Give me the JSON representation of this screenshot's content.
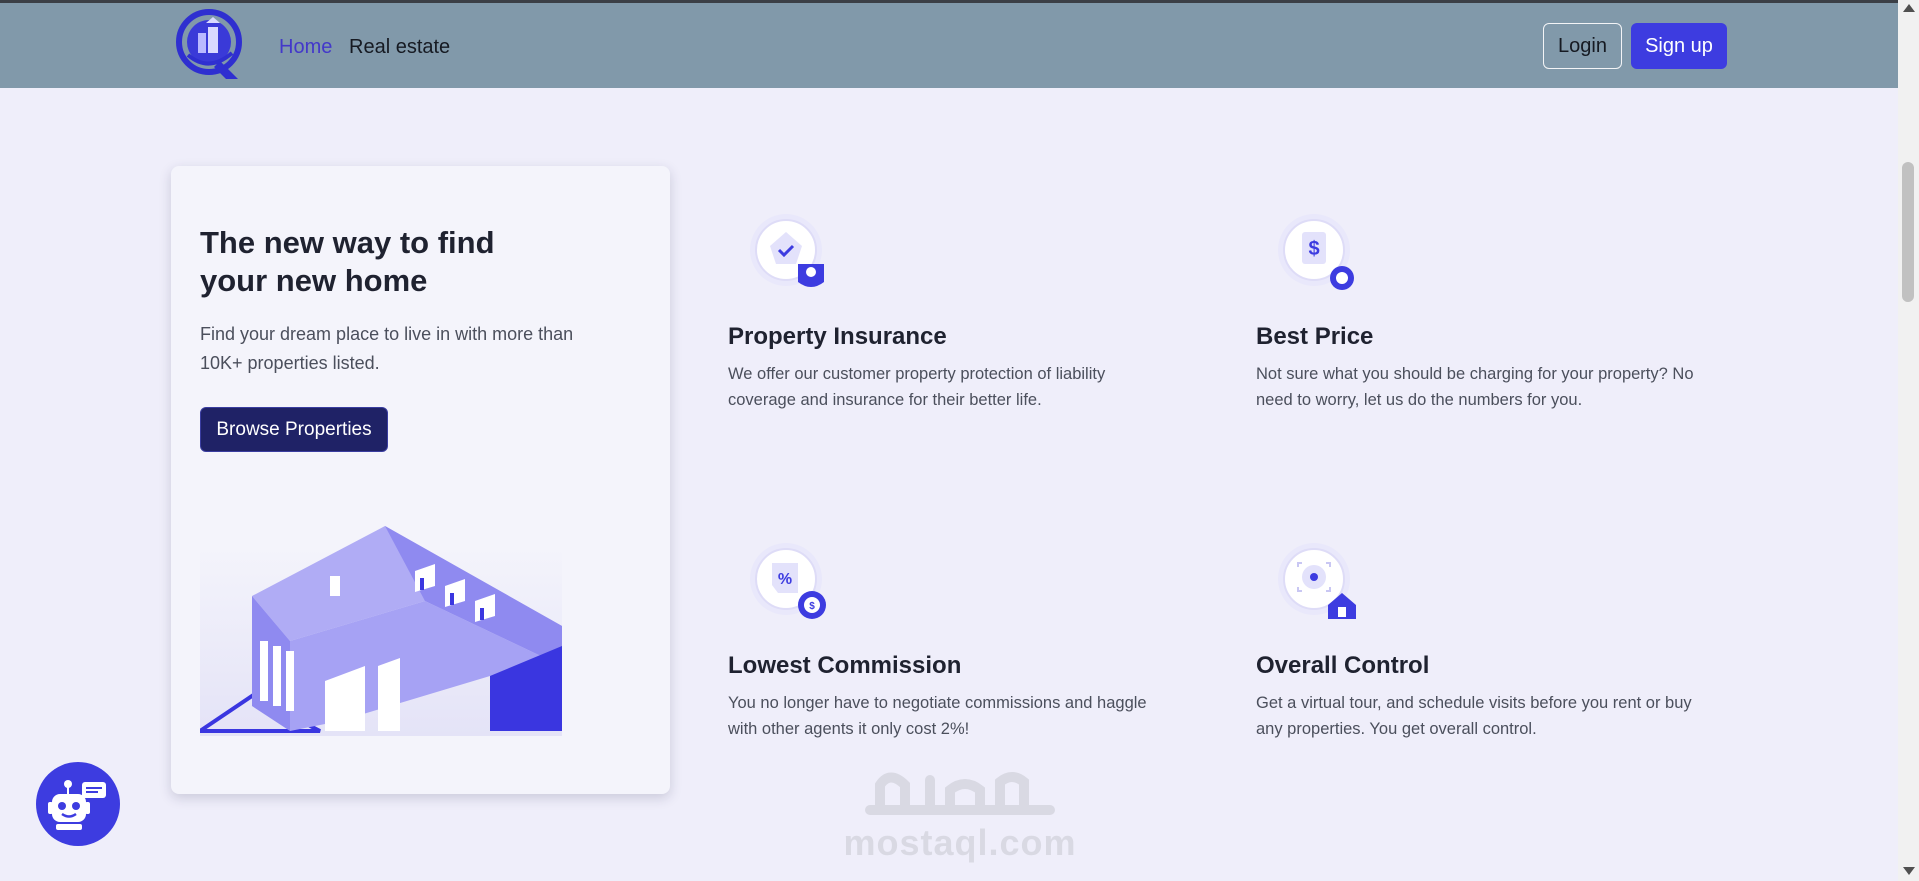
{
  "navbar": {
    "links": [
      {
        "label": "Home"
      },
      {
        "label": "Real estate"
      }
    ],
    "login_label": "Login",
    "signup_label": "Sign up"
  },
  "hero": {
    "title": "The new way to find your new home",
    "subtitle": "Find your dream place to live in with more than 10K+ properties listed.",
    "cta_label": "Browse Properties"
  },
  "features": [
    {
      "title": "Property Insurance",
      "description": "We offer our customer property protection of liability coverage and insurance for their better life.",
      "icon": "shield-house-icon"
    },
    {
      "title": "Best Price",
      "description": "Not sure what you should be charging for your property? No need to worry, let us do the numbers for you.",
      "icon": "price-tag-icon"
    },
    {
      "title": "Lowest Commission",
      "description": "You no longer have to negotiate commissions and haggle with other agents it only cost 2%!",
      "icon": "percent-tag-icon"
    },
    {
      "title": "Overall Control",
      "description": "Get a virtual tour, and schedule visits before you rent or buy any properties. You get overall control.",
      "icon": "target-house-icon"
    }
  ],
  "watermark": {
    "text": "mostaql.com"
  },
  "colors": {
    "navbar_bg": "#8199aa",
    "page_bg": "#efeefa",
    "accent": "#3d3ce0",
    "cta_bg": "#1f2266"
  }
}
